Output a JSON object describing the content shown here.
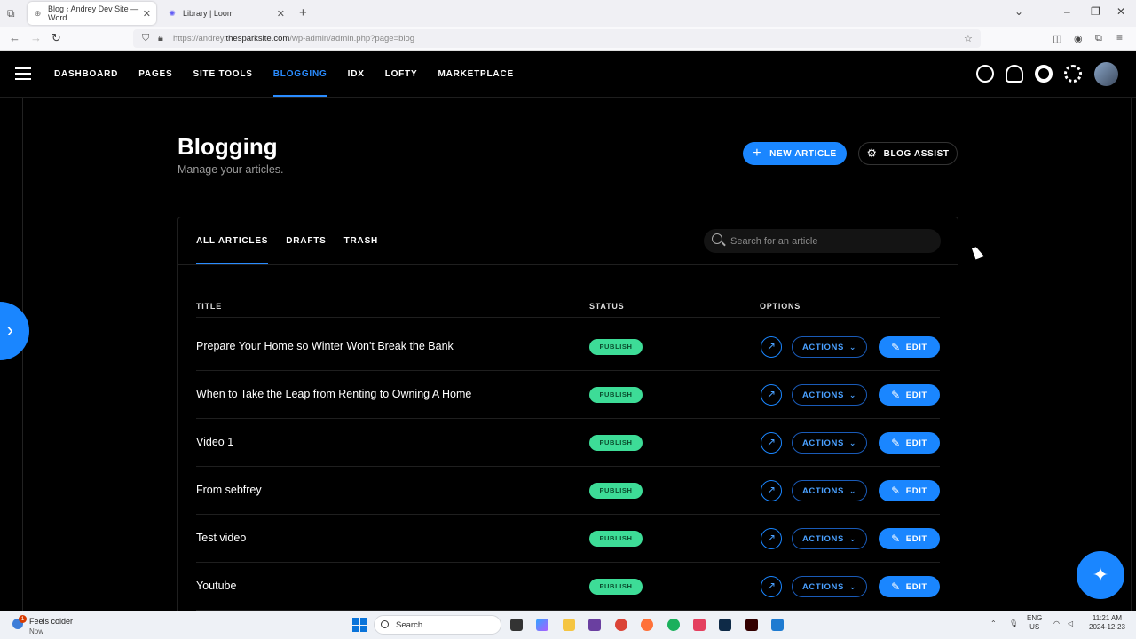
{
  "browser": {
    "tabs": [
      {
        "label": "Blog ‹ Andrey Dev Site — Word",
        "close": "✕",
        "active": true
      },
      {
        "label": "Library | Loom",
        "close": "✕",
        "active": false
      }
    ],
    "new_tab": "+",
    "address": {
      "prefix": "https://andrey.",
      "domain": "thesparksite.com",
      "suffix": "/wp-admin/admin.php?page=blog"
    }
  },
  "header": {
    "nav": [
      "DASHBOARD",
      "PAGES",
      "SITE TOOLS",
      "BLOGGING",
      "IDX",
      "LOFTY",
      "MARKETPLACE"
    ],
    "active": "BLOGGING"
  },
  "page": {
    "title": "Blogging",
    "subtitle": "Manage your articles.",
    "new_article": "NEW ARTICLE",
    "blog_assist": "BLOG ASSIST"
  },
  "tabs": [
    "ALL ARTICLES",
    "DRAFTS",
    "TRASH"
  ],
  "search": {
    "placeholder": "Search for an article"
  },
  "table": {
    "headers": {
      "title": "TITLE",
      "status": "STATUS",
      "options": "OPTIONS"
    },
    "rows": [
      {
        "title": "Prepare Your Home so Winter Won't Break the Bank",
        "status": "PUBLISH"
      },
      {
        "title": "When to Take the Leap from Renting to Owning A Home",
        "status": "PUBLISH"
      },
      {
        "title": "Video 1",
        "status": "PUBLISH"
      },
      {
        "title": "From sebfrey",
        "status": "PUBLISH"
      },
      {
        "title": "Test video",
        "status": "PUBLISH"
      },
      {
        "title": "Youtube",
        "status": "PUBLISH"
      }
    ],
    "actions_label": "ACTIONS",
    "edit_label": "EDIT"
  },
  "taskbar": {
    "weather": {
      "title": "Feels colder",
      "sub": "Now",
      "badge": "1"
    },
    "search": "Search",
    "lang": [
      "ENG",
      "US"
    ],
    "clock": [
      "11:21 AM",
      "2024-12-23"
    ]
  },
  "colors": {
    "accent": "#1a86ff",
    "publish": "#3ddc97"
  }
}
